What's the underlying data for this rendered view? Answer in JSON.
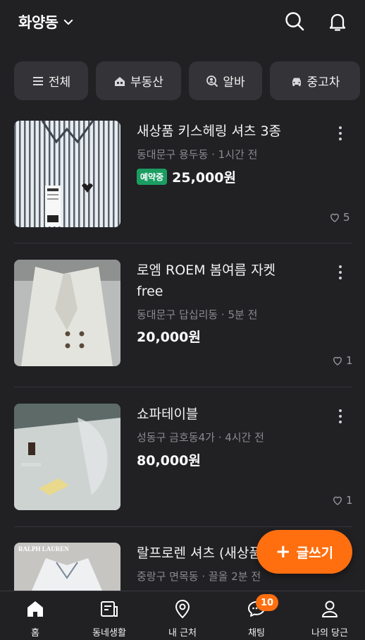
{
  "header": {
    "location": "화양동",
    "location_icon": "chevron-down-icon",
    "search_icon": "search-icon",
    "notification_icon": "bell-icon"
  },
  "categories": [
    {
      "label": "전체",
      "icon": "menu-icon"
    },
    {
      "label": "부동산",
      "icon": "house-icon"
    },
    {
      "label": "알바",
      "icon": "search-person-icon"
    },
    {
      "label": "중고차",
      "icon": "car-icon"
    }
  ],
  "listings": [
    {
      "title": "새상품 키스헤링 셔츠 3종",
      "meta": "동대문구 용두동 · 1시간 전",
      "badge": "예약중",
      "price": "25,000원",
      "likes": "5"
    },
    {
      "title": "로엠 ROEM 봄여름 자켓 free",
      "meta": "동대문구 답십리동 · 5분 전",
      "badge": "",
      "price": "20,000원",
      "likes": "1"
    },
    {
      "title": "쇼파테이블",
      "meta": "성동구 금호동4가 · 4시간 전",
      "badge": "",
      "price": "80,000원",
      "likes": "1"
    },
    {
      "title": "랄프로렌 셔츠 (새상품)",
      "meta": "중랑구 면목동 · 끌올 2분 전",
      "badge": "",
      "price": "",
      "likes": "",
      "thumb_text": "RALPH LAUREN"
    }
  ],
  "fab": {
    "label": "글쓰기",
    "icon": "plus-icon"
  },
  "nav": [
    {
      "label": "홈",
      "icon": "home-icon"
    },
    {
      "label": "동네생활",
      "icon": "community-icon"
    },
    {
      "label": "내 근처",
      "icon": "location-pin-icon"
    },
    {
      "label": "채팅",
      "icon": "chat-icon",
      "badge": "10"
    },
    {
      "label": "나의 당근",
      "icon": "person-icon"
    }
  ],
  "colors": {
    "accent": "#ff6f0f",
    "badge_green": "#1b9d62",
    "background": "#212124"
  }
}
